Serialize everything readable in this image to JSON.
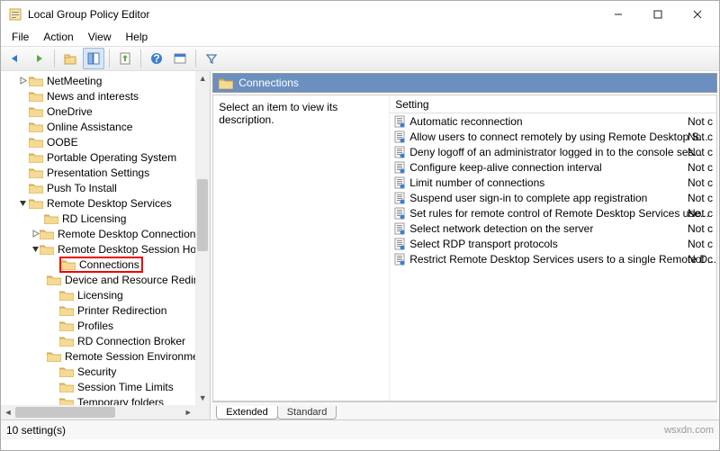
{
  "window": {
    "title": "Local Group Policy Editor"
  },
  "menu": {
    "file": "File",
    "action": "Action",
    "view": "View",
    "help": "Help"
  },
  "tree": {
    "items": [
      {
        "indent": 1,
        "label": "NetMeeting",
        "twisty": ">"
      },
      {
        "indent": 1,
        "label": "News and interests",
        "twisty": ""
      },
      {
        "indent": 1,
        "label": "OneDrive",
        "twisty": ""
      },
      {
        "indent": 1,
        "label": "Online Assistance",
        "twisty": ""
      },
      {
        "indent": 1,
        "label": "OOBE",
        "twisty": ""
      },
      {
        "indent": 1,
        "label": "Portable Operating System",
        "twisty": ""
      },
      {
        "indent": 1,
        "label": "Presentation Settings",
        "twisty": ""
      },
      {
        "indent": 1,
        "label": "Push To Install",
        "twisty": ""
      },
      {
        "indent": 1,
        "label": "Remote Desktop Services",
        "twisty": "v"
      },
      {
        "indent": 2,
        "label": "RD Licensing",
        "twisty": ""
      },
      {
        "indent": 2,
        "label": "Remote Desktop Connection Cli",
        "twisty": ">"
      },
      {
        "indent": 2,
        "label": "Remote Desktop Session Host",
        "twisty": "v"
      },
      {
        "indent": 3,
        "label": "Connections",
        "twisty": "",
        "selected": true
      },
      {
        "indent": 3,
        "label": "Device and Resource Redirec",
        "twisty": ""
      },
      {
        "indent": 3,
        "label": "Licensing",
        "twisty": ""
      },
      {
        "indent": 3,
        "label": "Printer Redirection",
        "twisty": ""
      },
      {
        "indent": 3,
        "label": "Profiles",
        "twisty": ""
      },
      {
        "indent": 3,
        "label": "RD Connection Broker",
        "twisty": ""
      },
      {
        "indent": 3,
        "label": "Remote Session Environmen",
        "twisty": ""
      },
      {
        "indent": 3,
        "label": "Security",
        "twisty": ""
      },
      {
        "indent": 3,
        "label": "Session Time Limits",
        "twisty": ""
      },
      {
        "indent": 3,
        "label": "Temporary folders",
        "twisty": ""
      }
    ]
  },
  "right": {
    "header": "Connections",
    "description_prompt": "Select an item to view its description.",
    "setting_col": "Setting",
    "state_label": "Not c",
    "settings": [
      "Automatic reconnection",
      "Allow users to connect remotely by using Remote Desktop S...",
      "Deny logoff of an administrator logged in to the console ses...",
      "Configure keep-alive connection interval",
      "Limit number of connections",
      "Suspend user sign-in to complete app registration",
      "Set rules for remote control of Remote Desktop Services use...",
      "Select network detection on the server",
      "Select RDP transport protocols",
      "Restrict Remote Desktop Services users to a single Remote D..."
    ]
  },
  "tabs": {
    "extended": "Extended",
    "standard": "Standard"
  },
  "status": {
    "count": "10 setting(s)",
    "watermark": "wsxdn.com"
  }
}
